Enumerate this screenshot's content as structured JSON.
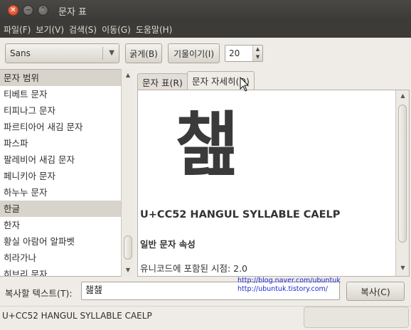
{
  "window": {
    "title": "문자 표"
  },
  "menu": [
    "파일(F)",
    "보기(V)",
    "검색(S)",
    "이동(G)",
    "도움말(H)"
  ],
  "toolbar": {
    "font_value": "Sans",
    "bold_label": "굵게(B)",
    "italic_label": "기울이기(I)",
    "size_value": "20"
  },
  "list": {
    "items": [
      {
        "label": "문자 범위",
        "state": "header"
      },
      {
        "label": "티베트 문자",
        "state": "normal"
      },
      {
        "label": "티피나그 문자",
        "state": "normal"
      },
      {
        "label": "파르티아어 새김 문자",
        "state": "normal"
      },
      {
        "label": "파스파",
        "state": "normal"
      },
      {
        "label": "팔레비어 새김 문자",
        "state": "normal"
      },
      {
        "label": "페니키아 문자",
        "state": "normal"
      },
      {
        "label": "하누누 문자",
        "state": "normal"
      },
      {
        "label": "한글",
        "state": "selected"
      },
      {
        "label": "한자",
        "state": "normal"
      },
      {
        "label": "황실 아람어 알파벳",
        "state": "normal"
      },
      {
        "label": "히라가나",
        "state": "normal"
      },
      {
        "label": "히브리 문자",
        "state": "normal"
      }
    ]
  },
  "tabs": {
    "table_label": "문자 표(R)",
    "details_label": "문자 자세히(D)"
  },
  "details": {
    "glyph": "챒",
    "char_name": "U+CC52 HANGUL SYLLABLE CAELP",
    "section_title": "일반 문자 속성",
    "property_line": "유니코드에 포함된 시점: 2.0"
  },
  "copy": {
    "label": "복사할 텍스트(T):",
    "value": "챒챒",
    "button_label": "복사(C)"
  },
  "watermark": {
    "line1": "http://blog.naver.com/ubuntuk",
    "line2": "http://ubuntuk.tistory.com/"
  },
  "status": {
    "text": "U+CC52 HANGUL SYLLABLE CAELP"
  }
}
